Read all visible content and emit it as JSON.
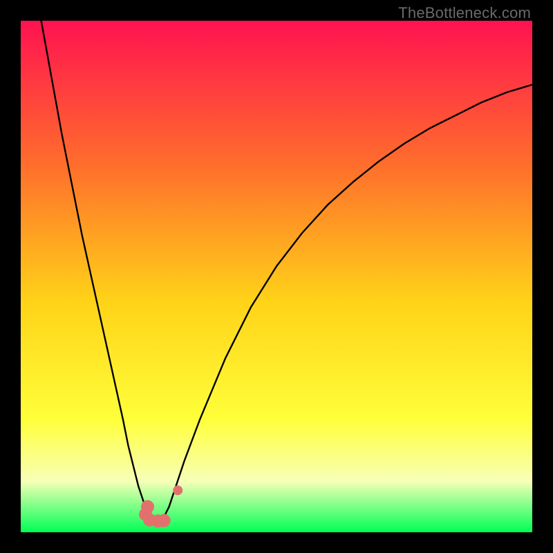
{
  "watermark": "TheBottleneck.com",
  "colors": {
    "frame": "#000000",
    "gradient_top": "#ff1250",
    "gradient_mid1": "#ff6d2c",
    "gradient_mid2": "#ffd318",
    "gradient_mid3": "#ffff3a",
    "gradient_pale": "#f7ffb7",
    "gradient_bottom": "#00ff55",
    "curve": "#000000",
    "marker": "#e2716e"
  },
  "chart_data": {
    "type": "line",
    "title": "",
    "xlabel": "",
    "ylabel": "",
    "xlim": [
      0,
      100
    ],
    "ylim": [
      0,
      100
    ],
    "series": [
      {
        "name": "left-curve",
        "x": [
          4,
          6,
          8,
          10,
          12,
          14,
          16,
          18,
          20,
          21,
          22,
          23,
          24,
          25,
          26,
          27
        ],
        "values": [
          100,
          89,
          78,
          68,
          58,
          49,
          40,
          31,
          22,
          17,
          13,
          9,
          6,
          4,
          2.5,
          2
        ]
      },
      {
        "name": "right-curve",
        "x": [
          27,
          28,
          29,
          30,
          32,
          35,
          40,
          45,
          50,
          55,
          60,
          65,
          70,
          75,
          80,
          85,
          90,
          95,
          100
        ],
        "values": [
          2,
          3,
          5,
          8,
          14,
          22,
          34,
          44,
          52,
          58.5,
          64,
          68.5,
          72.5,
          76,
          79,
          81.5,
          84,
          86,
          87.5
        ]
      }
    ],
    "markers": [
      {
        "name": "L-marker-1",
        "x": 24.8,
        "y": 5.0
      },
      {
        "name": "L-marker-2",
        "x": 24.4,
        "y": 3.5
      },
      {
        "name": "L-marker-3",
        "x": 25.2,
        "y": 2.4
      },
      {
        "name": "L-marker-4",
        "x": 26.8,
        "y": 2.2
      },
      {
        "name": "L-marker-5",
        "x": 28.0,
        "y": 2.3
      },
      {
        "name": "dot-marker",
        "x": 30.7,
        "y": 8.2
      }
    ],
    "minimum": {
      "x": 27,
      "y": 2
    }
  }
}
